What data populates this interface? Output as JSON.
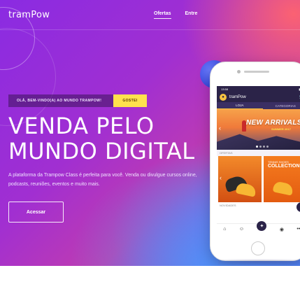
{
  "brand": {
    "logo": "tramPow"
  },
  "nav": {
    "items": [
      {
        "label": "Ofertas",
        "active": true
      },
      {
        "label": "Entre",
        "active": false
      }
    ]
  },
  "welcome": {
    "text": "OLÁ, BEM-VINDO(A) AO MUNDO TRAMPOW!",
    "button": "GOSTEI"
  },
  "hero": {
    "headline_line1": "VENDA PELO",
    "headline_line2": "MUNDO DIGITAL",
    "description": "A plataforma da Trampow Class é perfeita para você. Venda ou divulgue cursos online, podcasts, reuniões, eventos e muito mais.",
    "cta": "Acessar"
  },
  "phone": {
    "status_time": "13:58",
    "app_name": "tramPow",
    "tabs": [
      "LOJA",
      "CATEGORIAS"
    ],
    "banner_title": "NEW ARRIVALS",
    "banner_subtitle": "SUMMER 2017",
    "section1": "OFERTAS",
    "product_small": "TENNIS SHOES",
    "product_big": "COLLECTION",
    "section2": "NOVIDADES"
  },
  "colors": {
    "accent_yellow": "#ffe14d",
    "hero_purple": "#8a2be2",
    "app_dark": "#2b2348"
  },
  "icons": [
    "search-icon",
    "cart-icon",
    "home-icon",
    "chevron-left-icon",
    "chevron-right-icon",
    "more-icon",
    "user-icon"
  ]
}
